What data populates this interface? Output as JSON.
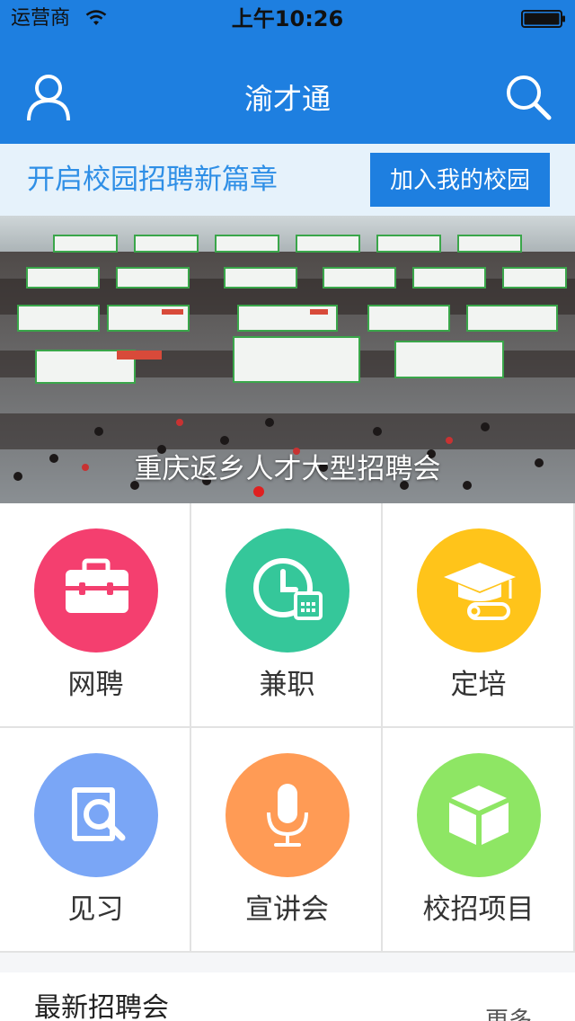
{
  "status_bar": {
    "carrier": "运营商",
    "time": "上午10:26",
    "wifi_icon": "wifi-icon",
    "battery_icon": "battery-icon"
  },
  "nav": {
    "title": "渝才通",
    "left_icon": "user-icon",
    "right_icon": "search-icon"
  },
  "campus_banner": {
    "slogan": "开启校园招聘新篇章",
    "button_label": "加入我的校园"
  },
  "carousel": {
    "caption": "重庆返乡人才大型招聘会",
    "active_index": 0
  },
  "grid": {
    "items": [
      {
        "label": "网聘",
        "icon": "briefcase-icon",
        "color": "#f43f6f"
      },
      {
        "label": "兼职",
        "icon": "clock-calendar-icon",
        "color": "#35c79a"
      },
      {
        "label": "定培",
        "icon": "graduation-cap-icon",
        "color": "#ffc41a"
      },
      {
        "label": "见习",
        "icon": "book-search-icon",
        "color": "#7aa6f6"
      },
      {
        "label": "宣讲会",
        "icon": "microphone-icon",
        "color": "#ff9b55"
      },
      {
        "label": "校招项目",
        "icon": "cube-icon",
        "color": "#8ee664"
      }
    ]
  },
  "section": {
    "title": "最新招聘会",
    "more": "更多"
  },
  "colors": {
    "brand": "#1e7fe0",
    "banner_bg": "#e6f2fb",
    "slogan": "#2f8fe6"
  }
}
